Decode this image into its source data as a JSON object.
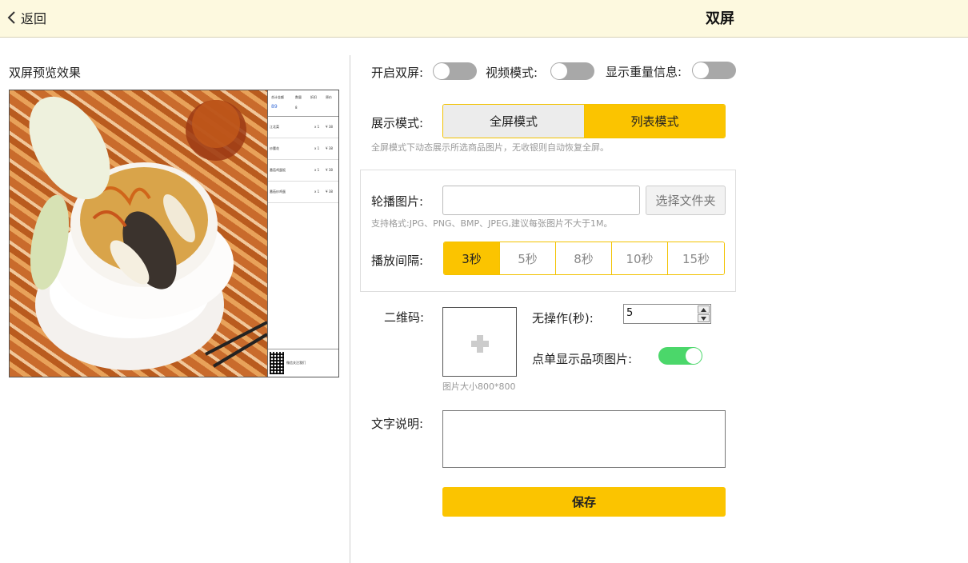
{
  "header": {
    "back_label": "返回",
    "title": "双屏"
  },
  "preview": {
    "title": "双屏预览效果",
    "receipt": {
      "head": [
        "合计金额",
        "数量",
        "折扣",
        "原价"
      ],
      "total": "89",
      "count": "8",
      "items": [
        {
          "name": "江北菜",
          "qty": "x 1",
          "price": "¥ 38"
        },
        {
          "name": "炒腰花",
          "qty": "x 1",
          "price": "¥ 38"
        },
        {
          "name": "番茄鸡蛋饭",
          "qty": "x 1",
          "price": "¥ 38"
        },
        {
          "name": "番茄炒鸡蛋",
          "qty": "x 1",
          "price": "¥ 38"
        }
      ],
      "foot_label": "微信关注我们"
    }
  },
  "settings": {
    "dual_label": "开启双屏:",
    "video_label": "视频模式:",
    "weight_label": "显示重量信息:",
    "display_mode_label": "展示模式:",
    "modes": [
      "全屏模式",
      "列表模式"
    ],
    "mode_hint": "全屏模式下动态展示所选商品图片，无收银则自动恢复全屏。",
    "carousel_label": "轮播图片:",
    "choose_folder": "选择文件夹",
    "format_hint": "支持格式:JPG、PNG、BMP、JPEG,建议每张图片不大于1M。",
    "interval_label": "播放间隔:",
    "intervals": [
      "3秒",
      "5秒",
      "8秒",
      "10秒",
      "15秒"
    ],
    "qr_label": "二维码:",
    "qr_hint": "图片大小800*800",
    "idle_label": "无操作(秒):",
    "idle_value": "5",
    "show_item_image_label": "点单显示品项图片:",
    "text_label": "文字说明:",
    "save": "保存"
  },
  "state": {
    "dual_on": false,
    "video_on": false,
    "weight_on": false,
    "selected_mode": "列表模式",
    "selected_interval": "3秒",
    "show_item_image_on": true
  },
  "colors": {
    "accent": "#fbc400",
    "toggle_on": "#4bd76a",
    "toggle_off": "#a8a8a8",
    "header_bg": "#fdf9df"
  }
}
